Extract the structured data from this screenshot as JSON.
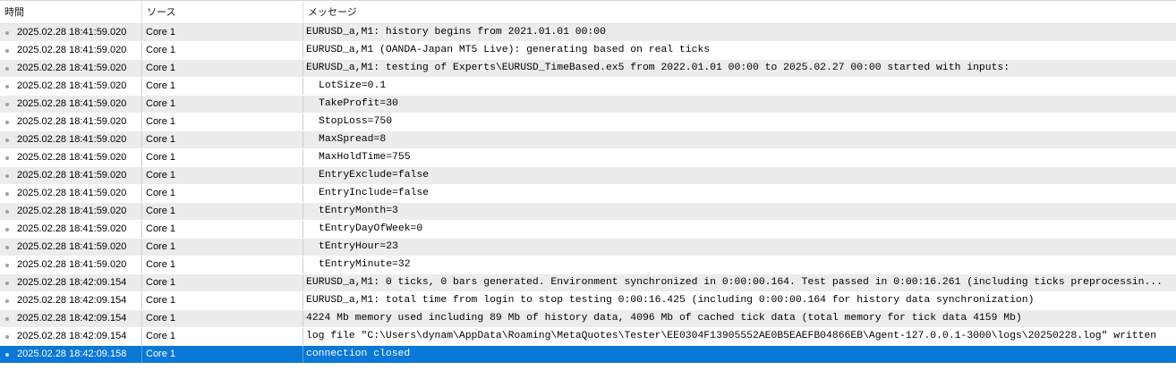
{
  "header": {
    "time_label": "時間",
    "source_label": "ソース",
    "message_label": "メッセージ"
  },
  "colors": {
    "selected_row": "#0a78d7",
    "alt_row": "#ececec",
    "bullet": "#a0a0a0"
  },
  "rows": [
    {
      "time": "2025.02.28 18:41:59.020",
      "source": "Core 1",
      "message": "EURUSD_a,M1: history begins from 2021.01.01 00:00",
      "indent": false,
      "icon": "bullet-icon"
    },
    {
      "time": "2025.02.28 18:41:59.020",
      "source": "Core 1",
      "message": "EURUSD_a,M1 (OANDA-Japan MT5 Live): generating based on real ticks",
      "indent": false,
      "icon": "bullet-icon"
    },
    {
      "time": "2025.02.28 18:41:59.020",
      "source": "Core 1",
      "message": "EURUSD_a,M1: testing of Experts\\EURUSD_TimeBased.ex5 from 2022.01.01 00:00 to 2025.02.27 00:00 started with inputs:",
      "indent": false,
      "icon": "bullet-icon"
    },
    {
      "time": "2025.02.28 18:41:59.020",
      "source": "Core 1",
      "message": "LotSize=0.1",
      "indent": true,
      "icon": "bullet-icon"
    },
    {
      "time": "2025.02.28 18:41:59.020",
      "source": "Core 1",
      "message": "TakeProfit=30",
      "indent": true,
      "icon": "bullet-icon"
    },
    {
      "time": "2025.02.28 18:41:59.020",
      "source": "Core 1",
      "message": "StopLoss=750",
      "indent": true,
      "icon": "bullet-icon"
    },
    {
      "time": "2025.02.28 18:41:59.020",
      "source": "Core 1",
      "message": "MaxSpread=8",
      "indent": true,
      "icon": "bullet-icon"
    },
    {
      "time": "2025.02.28 18:41:59.020",
      "source": "Core 1",
      "message": "MaxHoldTime=755",
      "indent": true,
      "icon": "bullet-icon"
    },
    {
      "time": "2025.02.28 18:41:59.020",
      "source": "Core 1",
      "message": "EntryExclude=false",
      "indent": true,
      "icon": "bullet-icon"
    },
    {
      "time": "2025.02.28 18:41:59.020",
      "source": "Core 1",
      "message": "EntryInclude=false",
      "indent": true,
      "icon": "bullet-icon"
    },
    {
      "time": "2025.02.28 18:41:59.020",
      "source": "Core 1",
      "message": "tEntryMonth=3",
      "indent": true,
      "icon": "bullet-icon"
    },
    {
      "time": "2025.02.28 18:41:59.020",
      "source": "Core 1",
      "message": "tEntryDayOfWeek=0",
      "indent": true,
      "icon": "bullet-icon"
    },
    {
      "time": "2025.02.28 18:41:59.020",
      "source": "Core 1",
      "message": "tEntryHour=23",
      "indent": true,
      "icon": "bullet-icon"
    },
    {
      "time": "2025.02.28 18:41:59.020",
      "source": "Core 1",
      "message": "tEntryMinute=32",
      "indent": true,
      "icon": "bullet-icon"
    },
    {
      "time": "2025.02.28 18:42:09.154",
      "source": "Core 1",
      "message": "EURUSD_a,M1: 0 ticks, 0 bars generated. Environment synchronized in 0:00:00.164. Test passed in 0:00:16.261 (including ticks preprocessin...",
      "indent": false,
      "icon": "bullet-icon"
    },
    {
      "time": "2025.02.28 18:42:09.154",
      "source": "Core 1",
      "message": "EURUSD_a,M1: total time from login to stop testing 0:00:16.425 (including 0:00:00.164 for history data synchronization)",
      "indent": false,
      "icon": "bullet-icon"
    },
    {
      "time": "2025.02.28 18:42:09.154",
      "source": "Core 1",
      "message": "4224 Mb memory used including 89 Mb of history data, 4096 Mb of cached tick data (total memory for tick data 4159 Mb)",
      "indent": false,
      "icon": "bullet-icon"
    },
    {
      "time": "2025.02.28 18:42:09.154",
      "source": "Core 1",
      "message": "log file \"C:\\Users\\dynam\\AppData\\Roaming\\MetaQuotes\\Tester\\EE0304F13905552AE0B5EAEFB04866EB\\Agent-127.0.0.1-3000\\logs\\20250228.log\" written",
      "indent": false,
      "icon": "bullet-icon"
    },
    {
      "time": "2025.02.28 18:42:09.158",
      "source": "Core 1",
      "message": "connection closed",
      "indent": false,
      "icon": "bullet-icon",
      "selected": true
    }
  ]
}
